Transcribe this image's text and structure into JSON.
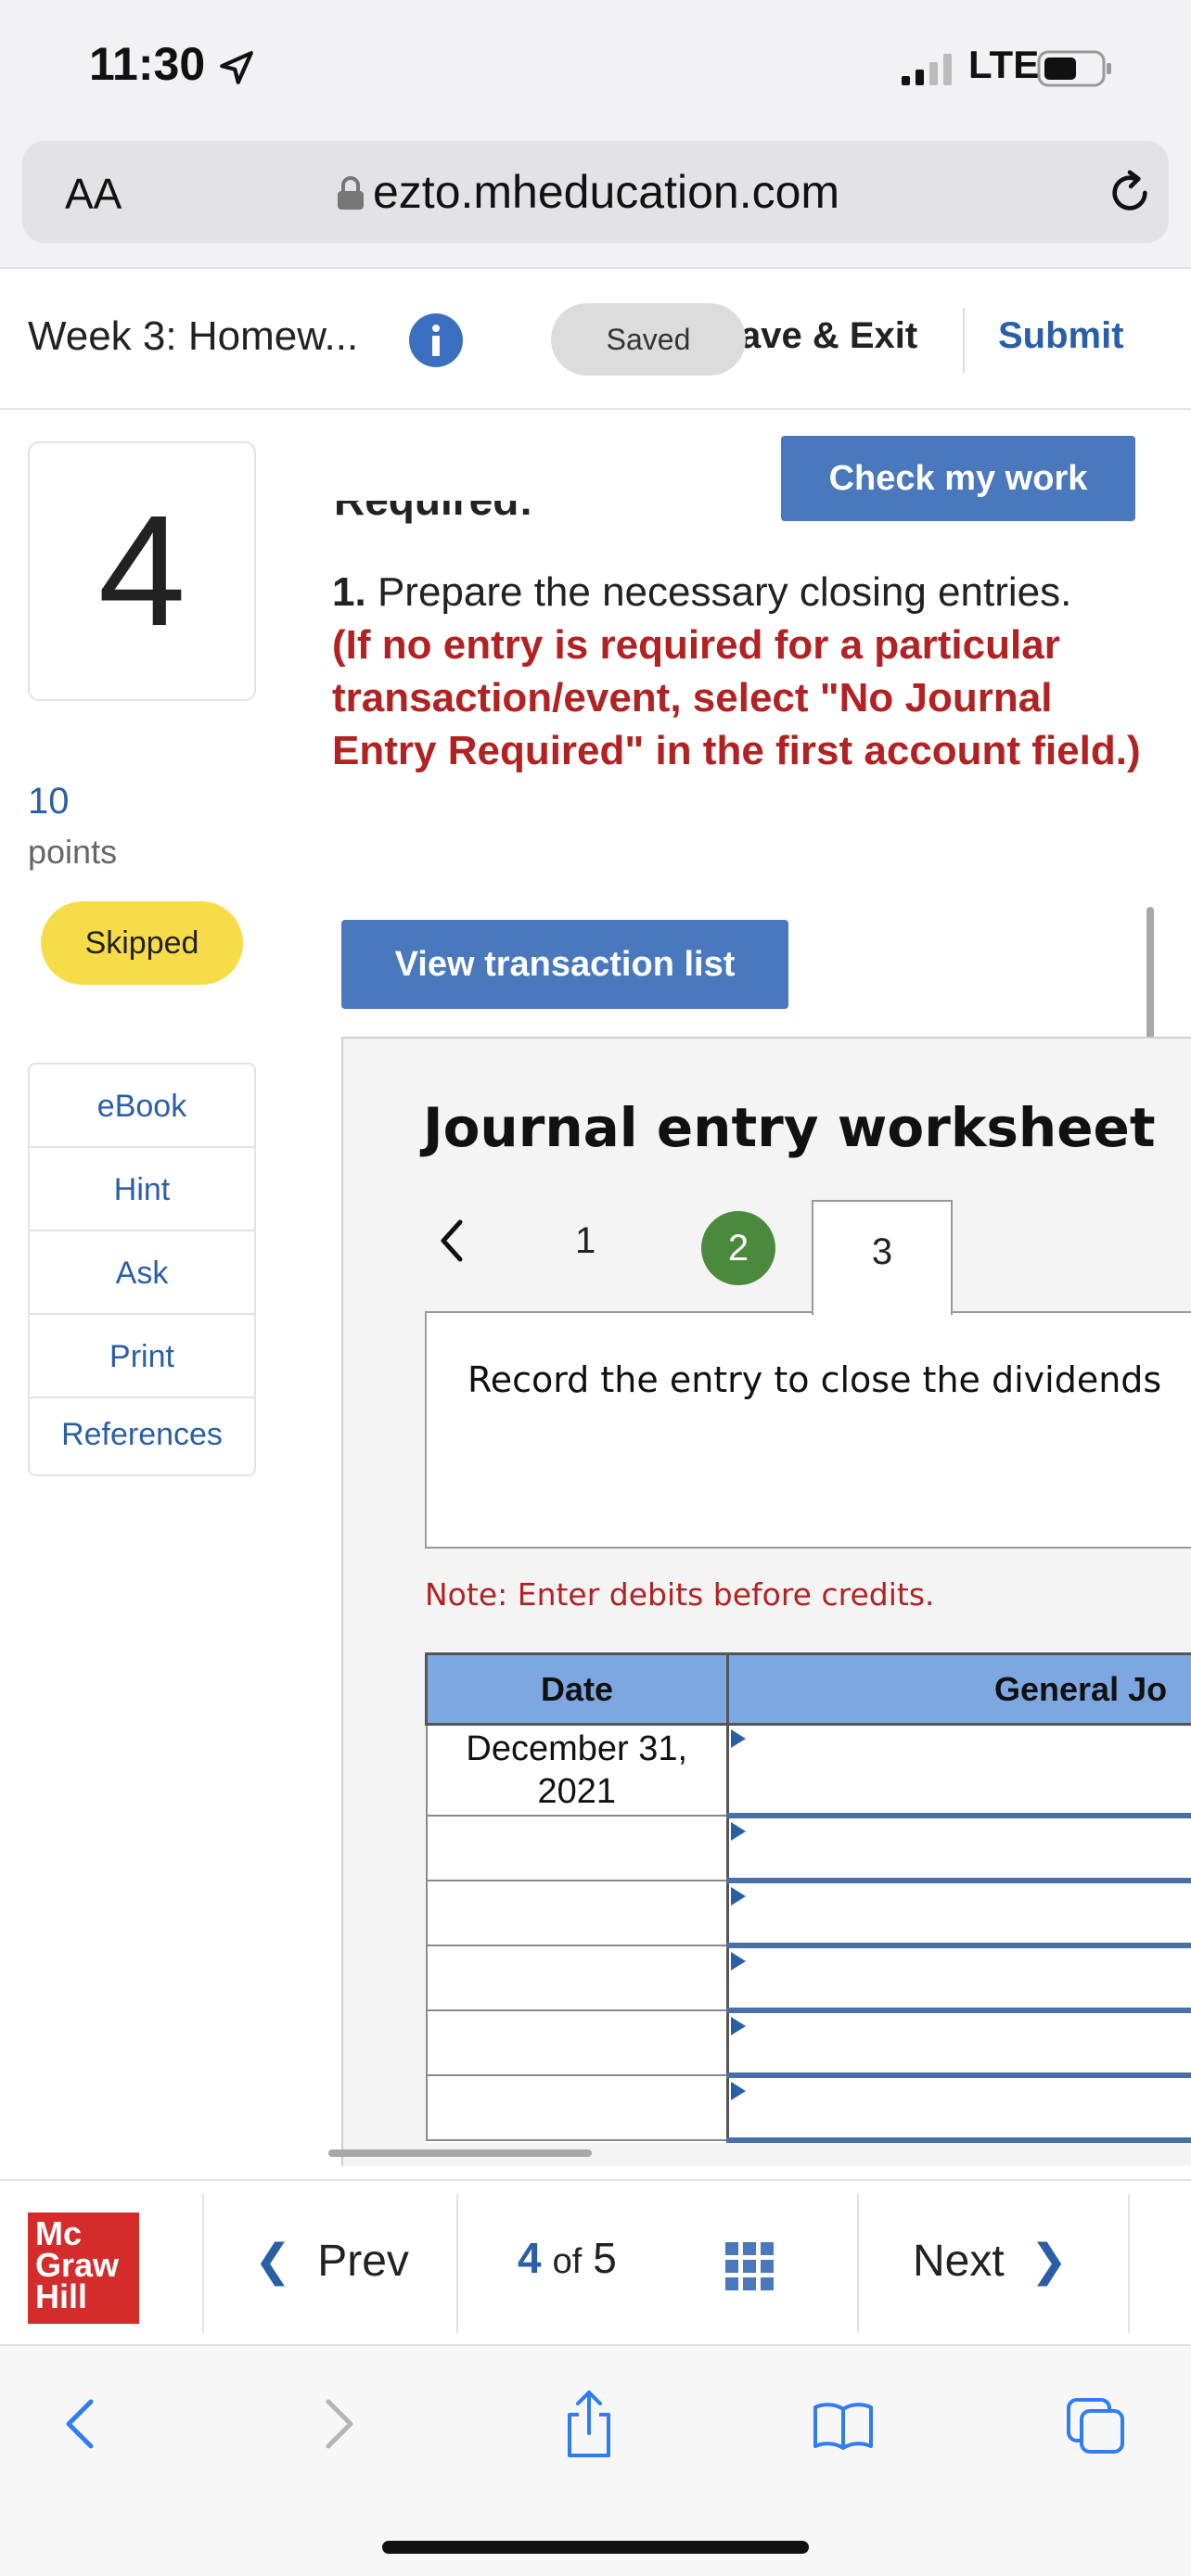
{
  "status_bar": {
    "time": "11:30",
    "network": "LTE"
  },
  "browser": {
    "text_size_label": "AA",
    "url": "ezto.mheducation.com"
  },
  "header": {
    "assignment_title": "Week 3: Homew...",
    "saved_label": "Saved",
    "save_exit_label": "ave & Exit",
    "submit_label": "Submit"
  },
  "question": {
    "number": "4",
    "points_value": "10",
    "points_label": "points",
    "status_badge": "Skipped"
  },
  "side_menu": {
    "items": [
      {
        "label": "eBook"
      },
      {
        "label": "Hint"
      },
      {
        "label": "Ask"
      },
      {
        "label": "Print"
      },
      {
        "label": "References"
      }
    ]
  },
  "content": {
    "check_button": "Check my work",
    "required_heading": "Required:",
    "instruction_number": "1.",
    "instruction_text": "Prepare the necessary closing entries.",
    "instruction_note": "(If no entry is required for a particular transaction/event, select \"No Journal Entry Required\" in the first account field.)",
    "view_transactions_button": "View transaction list"
  },
  "worksheet": {
    "title": "Journal entry worksheet",
    "tabs": [
      {
        "label": "1"
      },
      {
        "label": "2"
      },
      {
        "label": "3"
      }
    ],
    "active_tab": "3",
    "completed_tab": "2",
    "instruction": "Record the entry to close the dividends",
    "note": "Note: Enter debits before credits.",
    "table": {
      "headers": {
        "date": "Date",
        "account": "General Jo"
      },
      "rows": [
        {
          "date": "December 31,\n2021",
          "account": ""
        },
        {
          "date": "",
          "account": ""
        },
        {
          "date": "",
          "account": ""
        },
        {
          "date": "",
          "account": ""
        },
        {
          "date": "",
          "account": ""
        },
        {
          "date": "",
          "account": ""
        }
      ]
    }
  },
  "bottom_nav": {
    "logo_lines": [
      "Mc",
      "Graw",
      "Hill"
    ],
    "prev_label": "Prev",
    "current_page": "4",
    "of_label": "of",
    "total_pages": "5",
    "next_label": "Next"
  },
  "colors": {
    "accent_blue": "#4a78bd",
    "link_blue": "#2a5fa8",
    "alert_red": "#b22222",
    "completed_green": "#4b8a3d",
    "skipped_yellow": "#f7dc4a",
    "table_header_blue": "#7da7e0",
    "logo_red": "#d42b2b"
  }
}
